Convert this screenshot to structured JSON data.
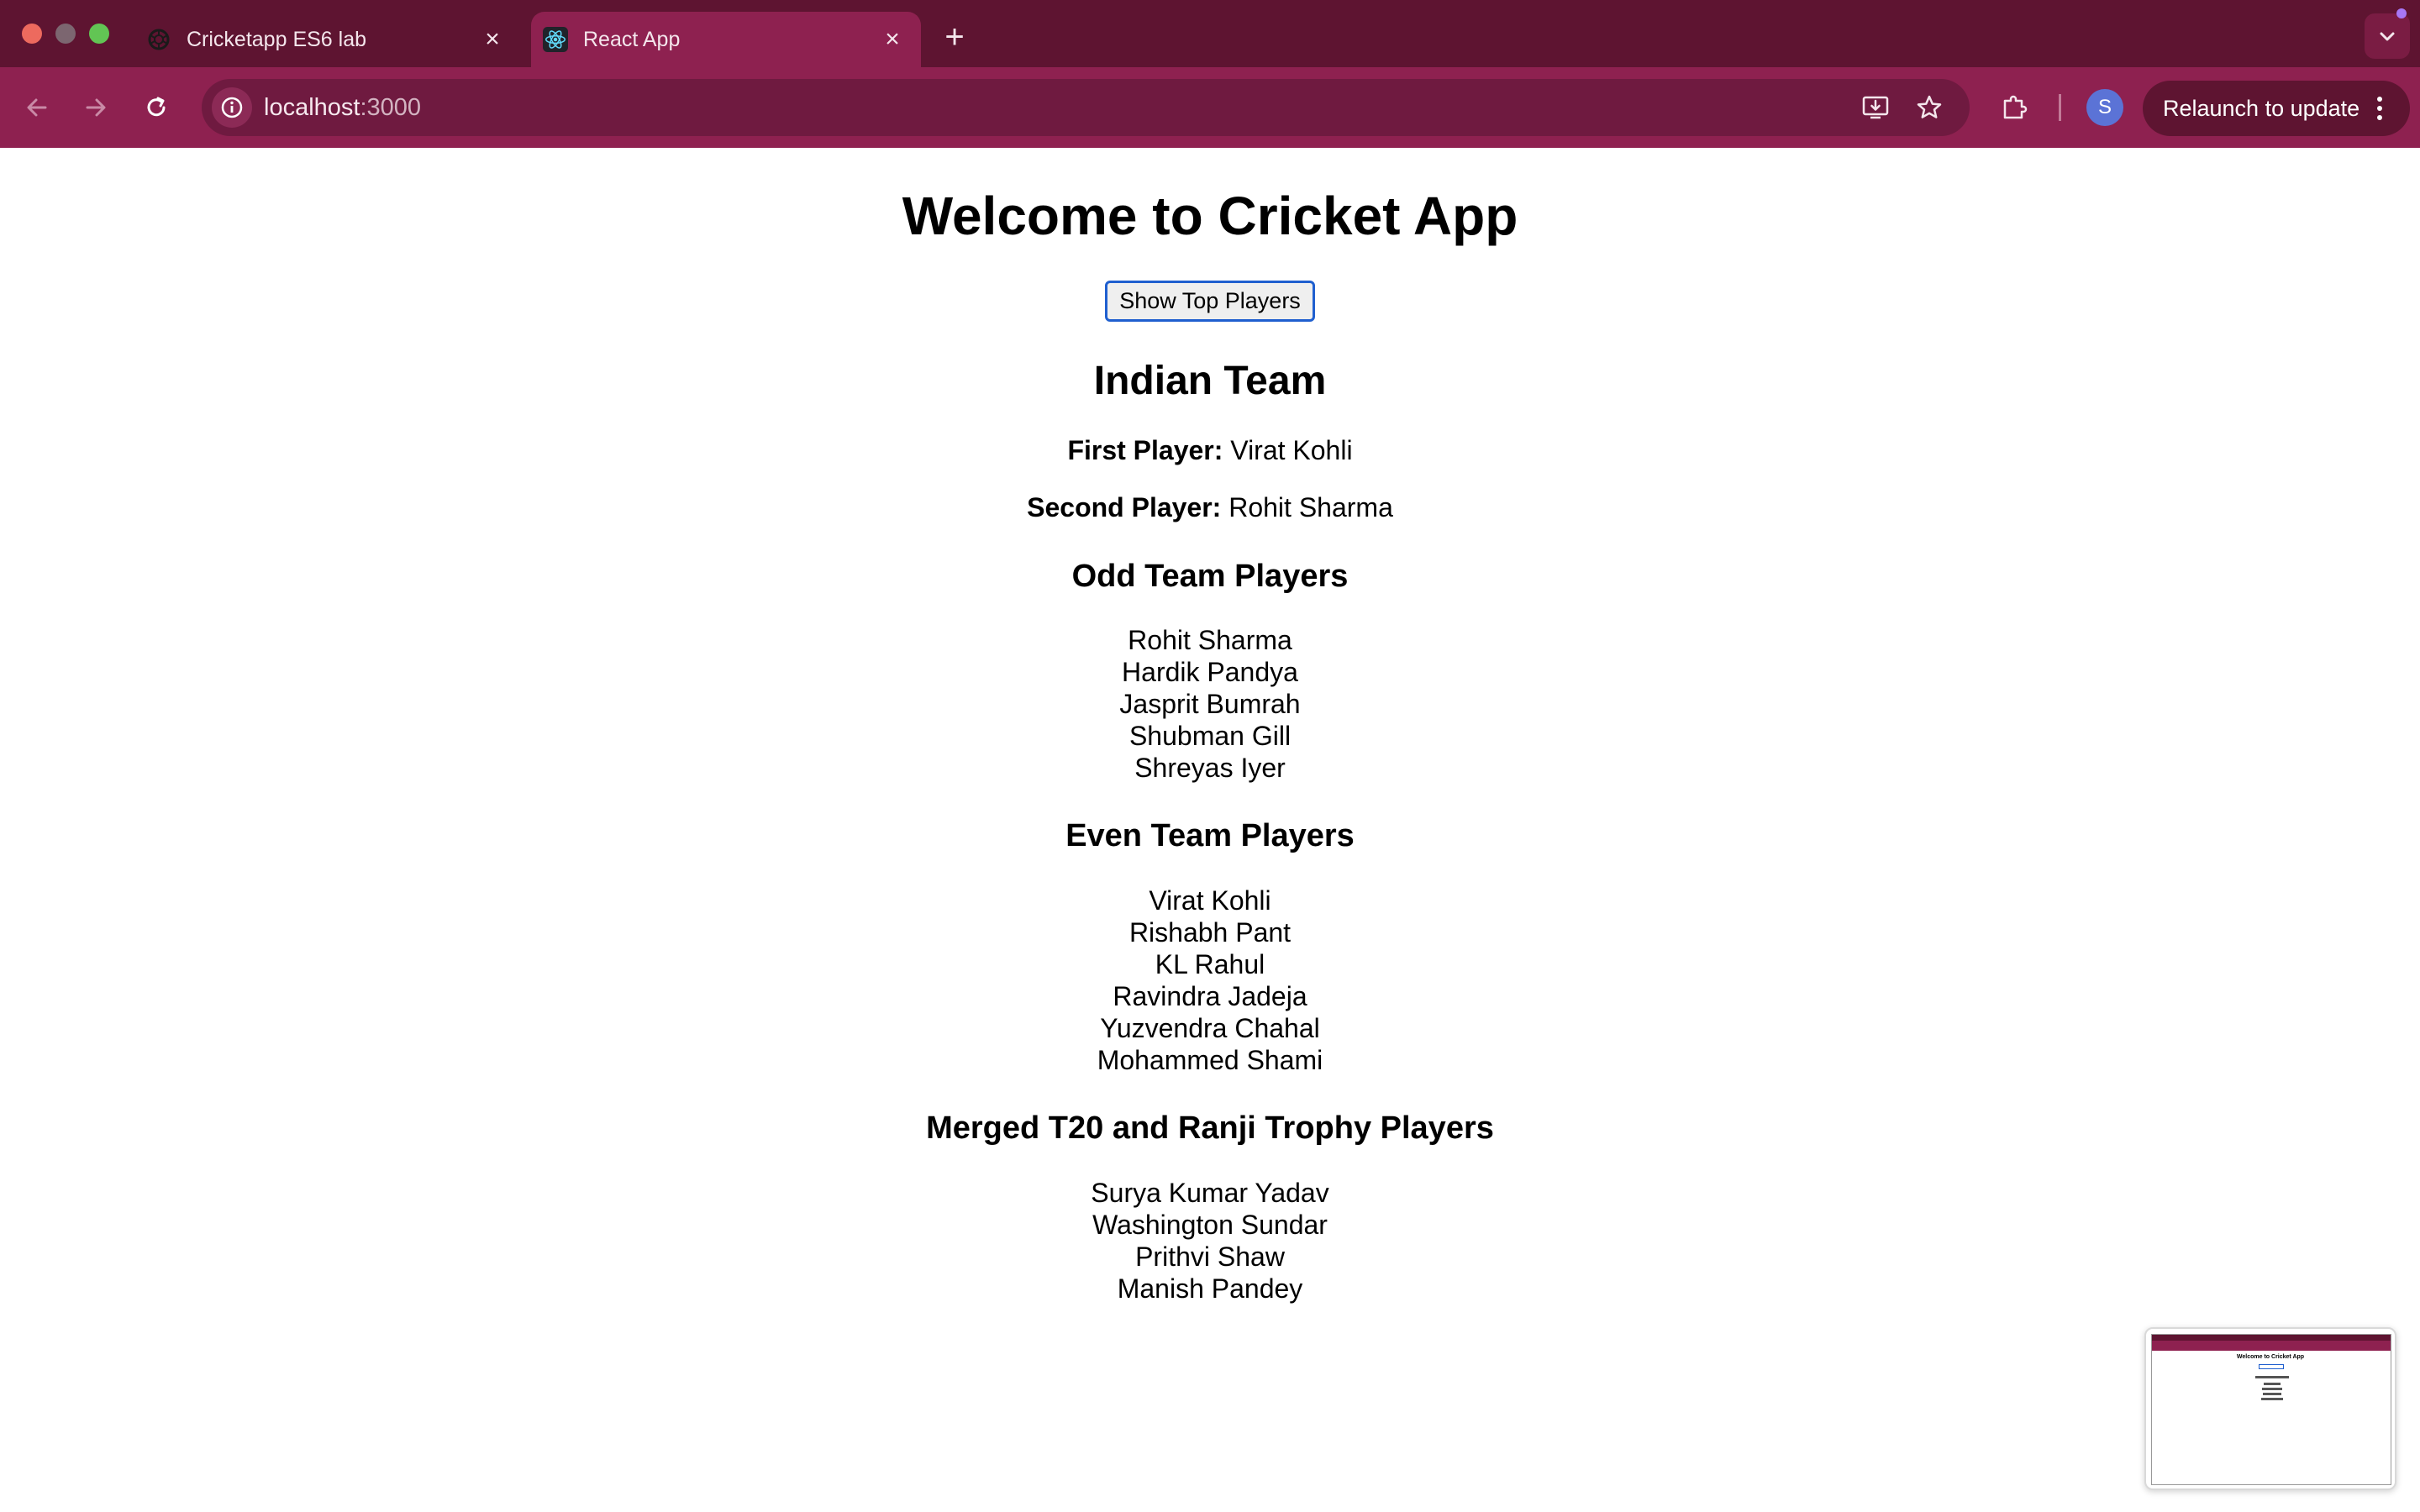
{
  "browser": {
    "tabs": [
      {
        "title": "Cricketapp ES6 lab",
        "favicon": "openai-icon",
        "active": false
      },
      {
        "title": "React App",
        "favicon": "react-icon",
        "active": true
      }
    ],
    "url_host": "localhost",
    "url_port": ":3000",
    "relaunch_label": "Relaunch to update",
    "profile_initial": "S",
    "colors": {
      "frame": "#5e1431",
      "toolbar": "#8e2150",
      "omnibox": "#6f1a40"
    }
  },
  "app": {
    "title": "Welcome to Cricket App",
    "show_button": "Show Top Players",
    "team_heading": "Indian Team",
    "first_player_label": "First Player:",
    "first_player_value": "Virat Kohli",
    "second_player_label": "Second Player:",
    "second_player_value": "Rohit Sharma",
    "odd_heading": "Odd Team Players",
    "odd_players": [
      "Rohit Sharma",
      "Hardik Pandya",
      "Jasprit Bumrah",
      "Shubman Gill",
      "Shreyas Iyer"
    ],
    "even_heading": "Even Team Players",
    "even_players": [
      "Virat Kohli",
      "Rishabh Pant",
      "KL Rahul",
      "Ravindra Jadeja",
      "Yuzvendra Chahal",
      "Mohammed Shami"
    ],
    "merged_heading": "Merged T20 and Ranji Trophy Players",
    "merged_players": [
      "Surya Kumar Yadav",
      "Washington Sundar",
      "Prithvi Shaw",
      "Manish Pandey"
    ]
  }
}
